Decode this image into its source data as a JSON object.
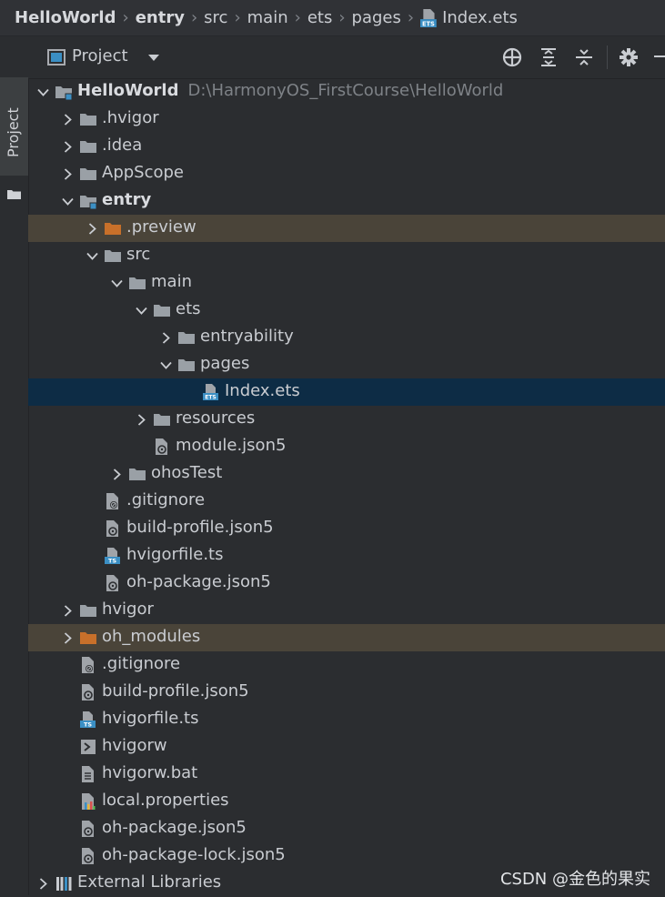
{
  "breadcrumb": [
    "HelloWorld",
    "entry",
    "src",
    "main",
    "ets",
    "pages",
    "Index.ets"
  ],
  "side_tab": {
    "label": "Project"
  },
  "panel": {
    "title": "Project"
  },
  "tree": [
    {
      "label": "HelloWorld",
      "hint": "D:\\HarmonyOS_FirstCourse\\HelloWorld",
      "depth": 0,
      "expand": "open",
      "icon": "module-folder-icon",
      "bold": true
    },
    {
      "label": ".hvigor",
      "depth": 1,
      "expand": "closed",
      "icon": "folder-icon"
    },
    {
      "label": ".idea",
      "depth": 1,
      "expand": "closed",
      "icon": "folder-icon"
    },
    {
      "label": "AppScope",
      "depth": 1,
      "expand": "closed",
      "icon": "folder-icon"
    },
    {
      "label": "entry",
      "depth": 1,
      "expand": "open",
      "icon": "module-folder-icon",
      "bold": true
    },
    {
      "label": ".preview",
      "depth": 2,
      "expand": "closed",
      "icon": "excluded-folder-icon",
      "highlight": "brown"
    },
    {
      "label": "src",
      "depth": 2,
      "expand": "open",
      "icon": "folder-icon"
    },
    {
      "label": "main",
      "depth": 3,
      "expand": "open",
      "icon": "folder-icon"
    },
    {
      "label": "ets",
      "depth": 4,
      "expand": "open",
      "icon": "folder-icon"
    },
    {
      "label": "entryability",
      "depth": 5,
      "expand": "closed",
      "icon": "folder-icon"
    },
    {
      "label": "pages",
      "depth": 5,
      "expand": "open",
      "icon": "folder-icon"
    },
    {
      "label": "Index.ets",
      "depth": 6,
      "icon": "ets-file-icon",
      "highlight": "selected"
    },
    {
      "label": "resources",
      "depth": 4,
      "expand": "closed",
      "icon": "folder-icon"
    },
    {
      "label": "module.json5",
      "depth": 4,
      "icon": "json-file-icon"
    },
    {
      "label": "ohosTest",
      "depth": 3,
      "expand": "closed",
      "icon": "folder-icon"
    },
    {
      "label": ".gitignore",
      "depth": 2,
      "icon": "ignore-file-icon"
    },
    {
      "label": "build-profile.json5",
      "depth": 2,
      "icon": "json-file-icon"
    },
    {
      "label": "hvigorfile.ts",
      "depth": 2,
      "icon": "ts-file-icon"
    },
    {
      "label": "oh-package.json5",
      "depth": 2,
      "icon": "json-file-icon"
    },
    {
      "label": "hvigor",
      "depth": 1,
      "expand": "closed",
      "icon": "folder-icon"
    },
    {
      "label": "oh_modules",
      "depth": 1,
      "expand": "closed",
      "icon": "excluded-folder-icon",
      "highlight": "brown"
    },
    {
      "label": ".gitignore",
      "depth": 1,
      "icon": "ignore-file-icon"
    },
    {
      "label": "build-profile.json5",
      "depth": 1,
      "icon": "json-file-icon"
    },
    {
      "label": "hvigorfile.ts",
      "depth": 1,
      "icon": "ts-file-icon"
    },
    {
      "label": "hvigorw",
      "depth": 1,
      "icon": "shell-file-icon"
    },
    {
      "label": "hvigorw.bat",
      "depth": 1,
      "icon": "text-file-icon"
    },
    {
      "label": "local.properties",
      "depth": 1,
      "icon": "properties-file-icon"
    },
    {
      "label": "oh-package.json5",
      "depth": 1,
      "icon": "json-file-icon"
    },
    {
      "label": "oh-package-lock.json5",
      "depth": 1,
      "icon": "json-file-icon"
    },
    {
      "label": "External Libraries",
      "depth": 0,
      "expand": "closed",
      "icon": "libraries-icon"
    }
  ],
  "watermark": "CSDN @金色的果实",
  "colors": {
    "background": "#2b2d30",
    "selection": "#0d2c45",
    "excluded_row": "#4a4439",
    "excluded_folder": "#c8702a",
    "folder": "#9aa0a6",
    "ets_badge": "#3b8fc4"
  }
}
